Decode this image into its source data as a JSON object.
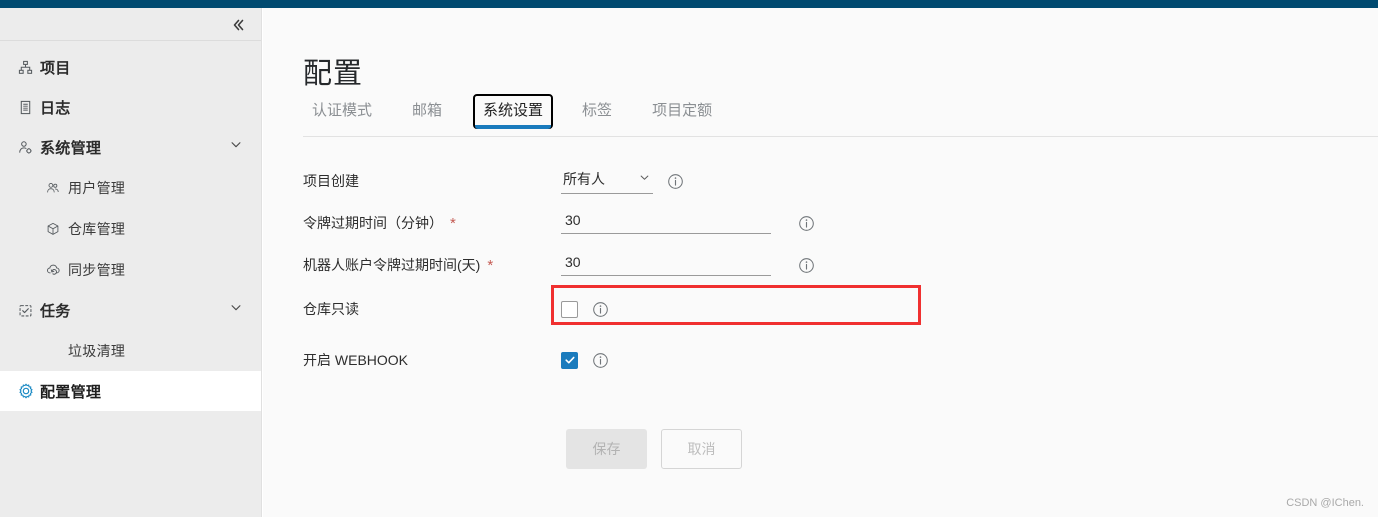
{
  "theme": {
    "topbar_color": "#004a70",
    "accent_color": "#1a7bbd",
    "sidebar_bg": "#ececec",
    "content_bg": "#fafafa",
    "highlight_color": "#f03030",
    "required_color": "#c45a52"
  },
  "sidebar": {
    "collapse_label": "«",
    "items": [
      {
        "label": "项目",
        "icon": "sitemap-icon",
        "level": "top",
        "active": false,
        "expandable": false
      },
      {
        "label": "日志",
        "icon": "log-document-icon",
        "level": "top",
        "active": false,
        "expandable": false
      },
      {
        "label": "系统管理",
        "icon": "user-gear-icon",
        "level": "top",
        "active": false,
        "expandable": true
      },
      {
        "label": "用户管理",
        "icon": "users-icon",
        "level": "sub",
        "active": false,
        "expandable": false
      },
      {
        "label": "仓库管理",
        "icon": "cube-icon",
        "level": "sub",
        "active": false,
        "expandable": false
      },
      {
        "label": "同步管理",
        "icon": "cloud-sync-icon",
        "level": "sub",
        "active": false,
        "expandable": false
      },
      {
        "label": "任务",
        "icon": "task-checklist-icon",
        "level": "top",
        "active": false,
        "expandable": true
      },
      {
        "label": "垃圾清理",
        "icon": "none",
        "level": "sub-noicon",
        "active": false,
        "expandable": false
      },
      {
        "label": "配置管理",
        "icon": "gear-icon",
        "level": "top",
        "active": true,
        "expandable": false
      }
    ]
  },
  "main": {
    "page_title": "配置",
    "tabs": [
      {
        "label": "认证模式",
        "active": false
      },
      {
        "label": "邮箱",
        "active": false
      },
      {
        "label": "系统设置",
        "active": true
      },
      {
        "label": "标签",
        "active": false
      },
      {
        "label": "项目定额",
        "active": false
      }
    ],
    "fields": {
      "project_creation": {
        "label": "项目创建",
        "type": "select",
        "value": "所有人",
        "required": false,
        "info": "info-icon"
      },
      "token_expiration": {
        "label": "令牌过期时间（分钟）",
        "type": "text",
        "value": "30",
        "required": true,
        "required_mark": "*",
        "info": "info-icon"
      },
      "robot_token_expiration": {
        "label": "机器人账户令牌过期时间(天)",
        "type": "text",
        "value": "30",
        "required": true,
        "required_mark": "*",
        "info": "info-icon"
      },
      "repo_readonly": {
        "label": "仓库只读",
        "type": "checkbox",
        "checked": false,
        "required": false,
        "info": "info-icon",
        "highlighted": true
      },
      "enable_webhook": {
        "label": "开启 WEBHOOK",
        "type": "checkbox",
        "checked": true,
        "required": false,
        "info": "info-icon"
      }
    },
    "buttons": {
      "save_label": "保存",
      "save_disabled": true,
      "cancel_label": "取消",
      "cancel_disabled": true
    }
  },
  "watermark": "CSDN @IChen."
}
